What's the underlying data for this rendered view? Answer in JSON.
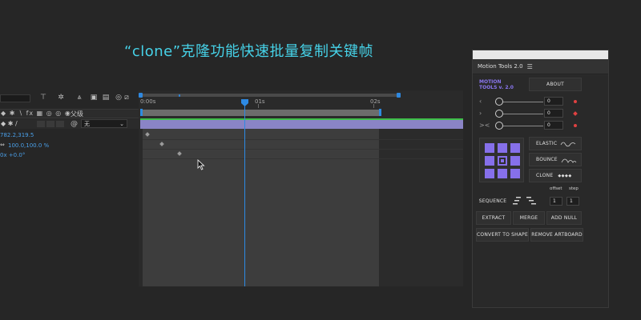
{
  "headline": "“clone”克隆功能快速批量复制关键帧",
  "timeline": {
    "column_switches": "◆ ✱ ∖ fx ▦ ◎ ◎ ◉",
    "parent_header": "父级",
    "layer_switches": "◆ ✱ /",
    "parent_value": "无",
    "props": [
      {
        "value": "782.2,319.5"
      },
      {
        "icon": "⇔",
        "value": "100.0,100.0 %"
      },
      {
        "value": "0x +0.0°"
      }
    ],
    "ruler_labels": [
      "0:00s",
      "01s",
      "02s"
    ]
  },
  "motion_tools": {
    "window_title": "Motion Tools 2.0",
    "menu_icon": "☰",
    "logo_line1": "MOTION",
    "logo_line2": "TOOLS v. 2.0",
    "about_label": "ABOUT",
    "sliders": [
      {
        "chevron": "‹",
        "value": "0"
      },
      {
        "chevron": "›",
        "value": "0"
      },
      {
        "chevron": "><",
        "value": "0"
      }
    ],
    "elastic_label": "ELASTIC",
    "bounce_label": "BOUNCE",
    "clone_label": "CLONE",
    "clone_glyph": "◆◆◆◆",
    "offset_label": "offset",
    "step_label": "step",
    "sequence_label": "SEQUENCE",
    "offset_value": "1",
    "step_value": "1",
    "extract_label": "EXTRACT",
    "merge_label": "MERGE",
    "add_null_label": "ADD NULL",
    "convert_label": "CONVERT TO SHAPE",
    "remove_label": "REMOVE ARTBOARD"
  },
  "colors": {
    "headline": "#46d2e8",
    "accent_purple": "#8670ea",
    "playhead_blue": "#2d8ae4",
    "layer_bar": "#8a84c6",
    "green_line": "#3fbf4a",
    "keyframe_red": "#e04141"
  }
}
